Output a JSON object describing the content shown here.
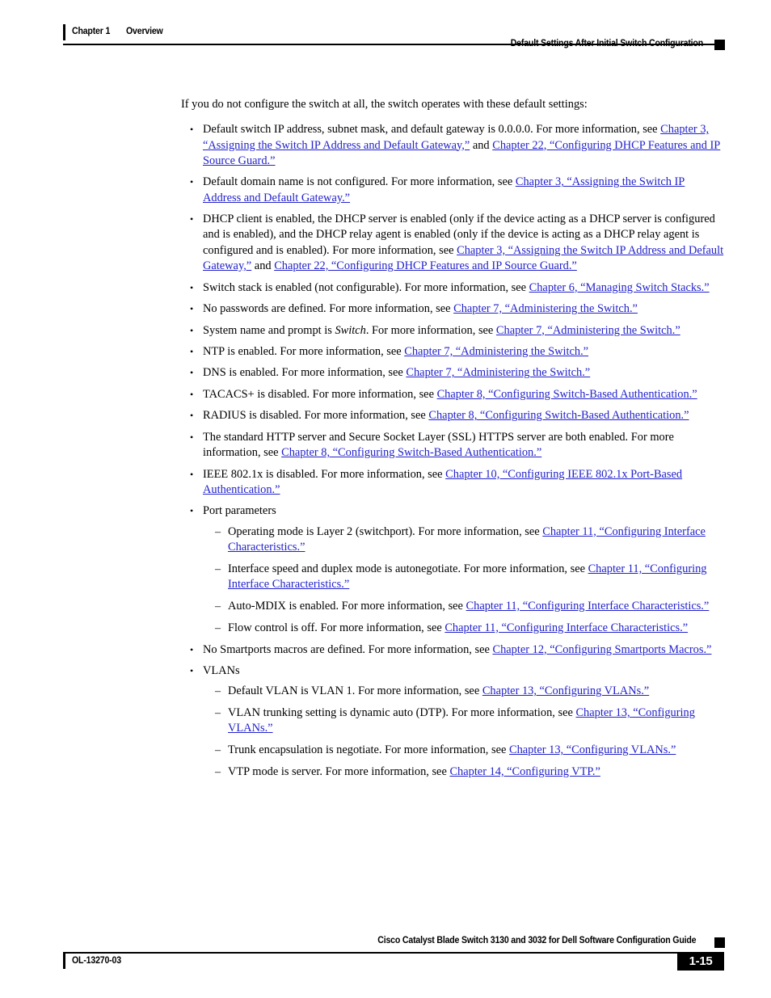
{
  "header": {
    "chapter_number": "Chapter 1",
    "chapter_title": "Overview",
    "section_title": "Default Settings After Initial Switch Configuration"
  },
  "body": {
    "intro": "If you do not configure the switch at all, the switch operates with these default settings:",
    "bullet_marker": "•",
    "dash_marker": "–",
    "items": [
      {
        "id": "default-ip-address",
        "text_1": "Default switch IP address, subnet mask, and default gateway is 0.0.0.0. For more information, see ",
        "xref_1": "Chapter 3, “Assigning the Switch IP Address and Default Gateway,”",
        "text_2": " and ",
        "xref_2": "Chapter 22, “Configuring DHCP Features and IP Source Guard.”"
      },
      {
        "id": "default-domain-name",
        "text_1": "Default domain name is not configured. For more information, see ",
        "xref_1": "Chapter 3, “Assigning the Switch IP Address and Default Gateway.”"
      },
      {
        "id": "dhcp-client",
        "text_1": "DHCP client is enabled, the DHCP server is enabled (only if the device acting as a DHCP server is configured and is enabled), and the DHCP relay agent is enabled (only if the device is acting as a DHCP relay agent is configured and is enabled). For more information, see ",
        "xref_1": "Chapter 3, “Assigning the Switch IP Address and Default Gateway,”",
        "text_2": " and ",
        "xref_2": "Chapter 22, “Configuring DHCP Features and IP Source Guard.”"
      },
      {
        "id": "switch-stack",
        "text_1": "Switch stack is enabled (not configurable). For more information, see ",
        "xref_1": "Chapter 6, “Managing Switch Stacks.”"
      },
      {
        "id": "no-passwords",
        "text_1": "No passwords are defined. For more information, see ",
        "xref_1": "Chapter 7, “Administering the Switch.”"
      },
      {
        "id": "system-name-prompt",
        "text_1": "System name and prompt is ",
        "italic_1": "Switch",
        "text_2": ". For more information, see ",
        "xref_1": "Chapter 7, “Administering the Switch.”"
      },
      {
        "id": "ntp-enabled",
        "text_1": "NTP is enabled. For more information, see ",
        "xref_1": "Chapter 7, “Administering the Switch.”"
      },
      {
        "id": "dns-enabled",
        "text_1": "DNS is enabled. For more information, see ",
        "xref_1": "Chapter 7, “Administering the Switch.”"
      },
      {
        "id": "tacacs-disabled",
        "text_1": "TACACS+ is disabled. For more information, see ",
        "xref_1": "Chapter 8, “Configuring Switch-Based Authentication.”"
      },
      {
        "id": "radius-disabled",
        "text_1": "RADIUS is disabled. For more information, see ",
        "xref_1": "Chapter 8, “Configuring Switch-Based Authentication.”"
      },
      {
        "id": "http-https-server",
        "text_1": "The standard HTTP server and Secure Socket Layer (SSL) HTTPS server are both enabled. For more information, see ",
        "xref_1": "Chapter 8, “Configuring Switch-Based Authentication.”"
      },
      {
        "id": "ieee-8021x-disabled",
        "text_1": "IEEE 802.1x is disabled. For more information, see ",
        "xref_1": "Chapter 10, “Configuring IEEE 802.1x Port-Based Authentication.”"
      },
      {
        "id": "port-parameters",
        "text_1": "Port parameters",
        "subitems": [
          {
            "id": "operating-mode",
            "text_1": "Operating mode is Layer 2 (switchport). For more information, see ",
            "xref_1": "Chapter 11, “Configuring Interface Characteristics.”"
          },
          {
            "id": "speed-duplex",
            "text_1": "Interface speed and duplex mode is autonegotiate. For more information, see ",
            "xref_1": "Chapter 11, “Configuring Interface Characteristics.”"
          },
          {
            "id": "auto-mdix",
            "text_1": "Auto-MDIX is enabled. For more information, see ",
            "xref_1": "Chapter 11, “Configuring Interface Characteristics.”"
          },
          {
            "id": "flow-control",
            "text_1": "Flow control is off. For more information, see ",
            "xref_1": "Chapter 11, “Configuring Interface Characteristics.”"
          }
        ]
      },
      {
        "id": "smartports-macros",
        "text_1": "No Smartports macros are defined. For more information, see ",
        "xref_1": "Chapter 12, “Configuring Smartports Macros.”"
      },
      {
        "id": "vlans",
        "text_1": "VLANs",
        "subitems": [
          {
            "id": "default-vlan",
            "text_1": "Default VLAN is VLAN 1. For more information, see ",
            "xref_1": "Chapter 13, “Configuring VLANs.”"
          },
          {
            "id": "vlan-trunking",
            "text_1": "VLAN trunking setting is dynamic auto (DTP). For more information, see ",
            "xref_1": "Chapter 13, “Configuring VLANs.”"
          },
          {
            "id": "trunk-encapsulation",
            "text_1": "Trunk encapsulation is negotiate. For more information, see ",
            "xref_1": "Chapter 13, “Configuring VLANs.”"
          },
          {
            "id": "vtp-mode",
            "text_1": "VTP mode is server. For more information, see ",
            "xref_1": "Chapter 14, “Configuring VTP.”"
          }
        ]
      }
    ]
  },
  "footer": {
    "document_title": "Cisco Catalyst Blade Switch 3130 and 3032 for Dell Software Configuration Guide",
    "doc_id": "OL-13270-03",
    "page_number": "1-15"
  },
  "colors": {
    "xref_link": "#2222cc",
    "text": "#000000",
    "rule": "#000000"
  }
}
